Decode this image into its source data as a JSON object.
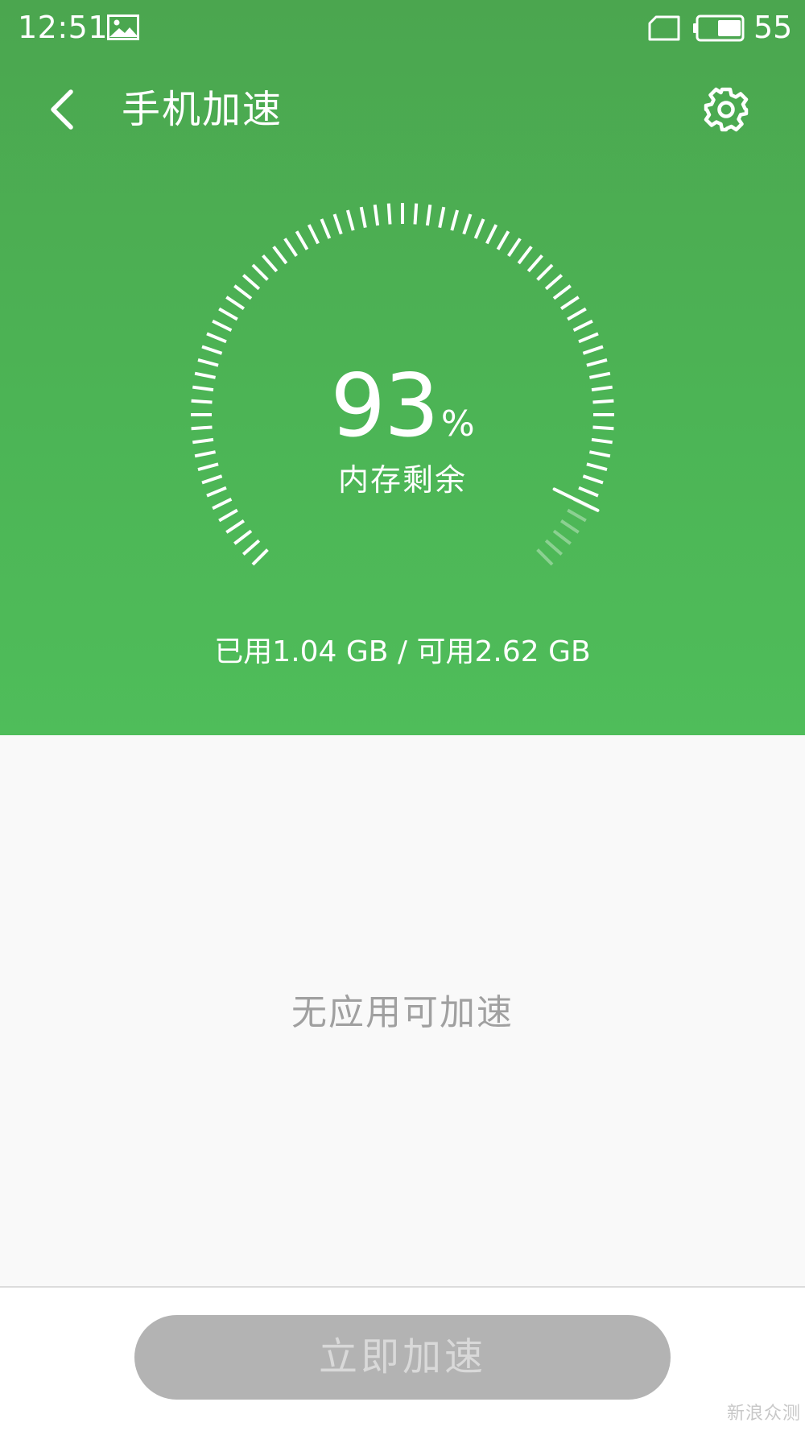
{
  "status_bar": {
    "time": "12:51",
    "battery_level": "55",
    "icons": [
      "gallery-icon",
      "sim-icon",
      "battery-icon"
    ]
  },
  "header": {
    "title": "手机加速",
    "back_icon": "chevron-left-icon",
    "settings_icon": "gear-icon"
  },
  "gauge": {
    "value": "93",
    "unit": "%",
    "label": "内存剩余",
    "fraction": 0.93
  },
  "memory": {
    "summary": "已用1.04 GB / 可用2.62 GB"
  },
  "content": {
    "empty_message": "无应用可加速"
  },
  "actions": {
    "boost_label": "立即加速",
    "enabled": false
  },
  "watermark": {
    "text": "新浪众测"
  },
  "colors": {
    "header_top": "#4ba64f",
    "header_bottom": "#4fbd5a",
    "content_bg": "#f9f9f9",
    "button_bg": "#b3b3b3",
    "button_text": "#d9d9d9",
    "empty_text": "#a0a0a0"
  }
}
